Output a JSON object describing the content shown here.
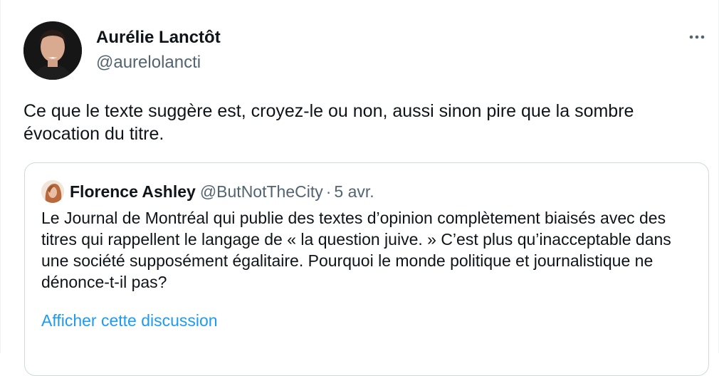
{
  "author": {
    "name": "Aurélie Lanctôt",
    "handle": "@aurelolancti"
  },
  "tweet": {
    "text": "Ce que le texte suggère est, croyez-le ou non, aussi sinon pire que la sombre évocation du titre."
  },
  "quoted": {
    "name": "Florence Ashley",
    "handle": "@ButNotTheCity",
    "separator": "·",
    "date": "5 avr.",
    "text": "Le Journal de Montréal qui publie des textes d’opinion complètement biaisés avec des titres qui rappellent le langage de « la question juive. » C’est plus qu’inacceptable dans une société supposément égalitaire. Pourquoi le monde politique et journalistique ne dénonce-t-il pas?",
    "show_thread_link": "Afficher cette discussion"
  },
  "icons": {
    "more": "more-icon",
    "author_avatar": "avatar",
    "quoted_avatar": "avatar"
  },
  "colors": {
    "link": "#1d9bf0",
    "secondary_text": "#536471",
    "border": "#cfd9de"
  }
}
